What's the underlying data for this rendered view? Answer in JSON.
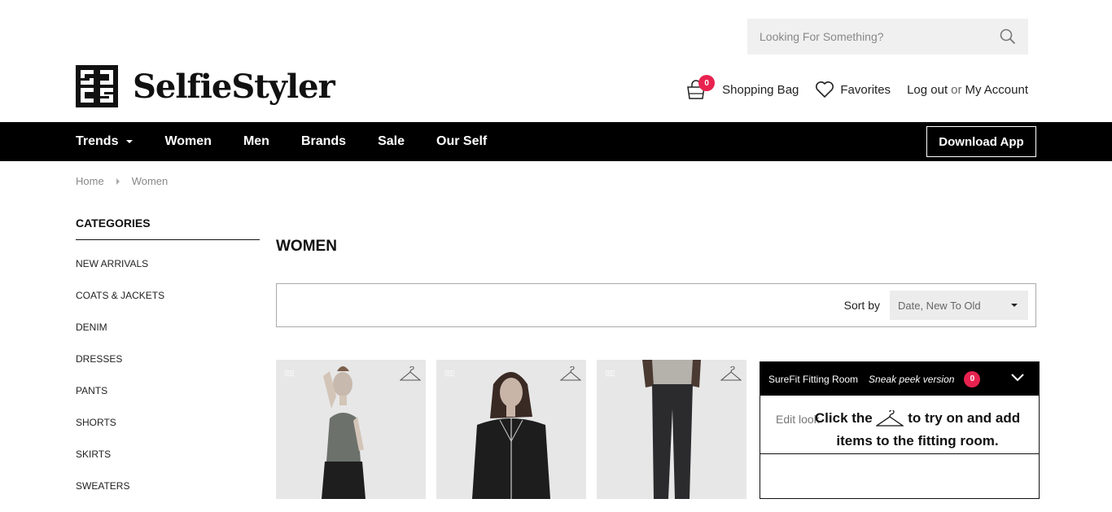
{
  "brand": {
    "name": "SelfieStyler"
  },
  "search": {
    "placeholder": "Looking For Something?"
  },
  "user_nav": {
    "bag_label": "Shopping Bag",
    "bag_count": "0",
    "favorites_label": "Favorites",
    "logout_label": "Log out",
    "or_text": "or",
    "account_label": "My Account"
  },
  "main_nav": {
    "items": [
      "Trends",
      "Women",
      "Men",
      "Brands",
      "Sale",
      "Our Self"
    ],
    "download_label": "Download App"
  },
  "breadcrumb": {
    "home": "Home",
    "current": "Women"
  },
  "sidebar": {
    "heading": "CATEGORIES",
    "items": [
      "NEW ARRIVALS",
      "COATS & JACKETS",
      "DENIM",
      "DRESSES",
      "PANTS",
      "SHORTS",
      "SKIRTS",
      "SWEATERS"
    ]
  },
  "main": {
    "title": "WOMEN"
  },
  "sort": {
    "label": "Sort by",
    "selected": "Date, New To Old"
  },
  "products": [
    {
      "tag": "▯▯▯"
    },
    {
      "tag": "▯▯▯"
    },
    {
      "tag": "▯▯▯"
    }
  ],
  "fitting_room": {
    "title": "SureFit Fitting Room",
    "subtitle": "Sneak peek version",
    "count": "0",
    "edit_label": "Edit look",
    "msg_part1": "Click the",
    "msg_part2": "to try on and add items to the fitting room."
  },
  "colors": {
    "accent": "#e8224f",
    "nav_bg": "#000000"
  }
}
